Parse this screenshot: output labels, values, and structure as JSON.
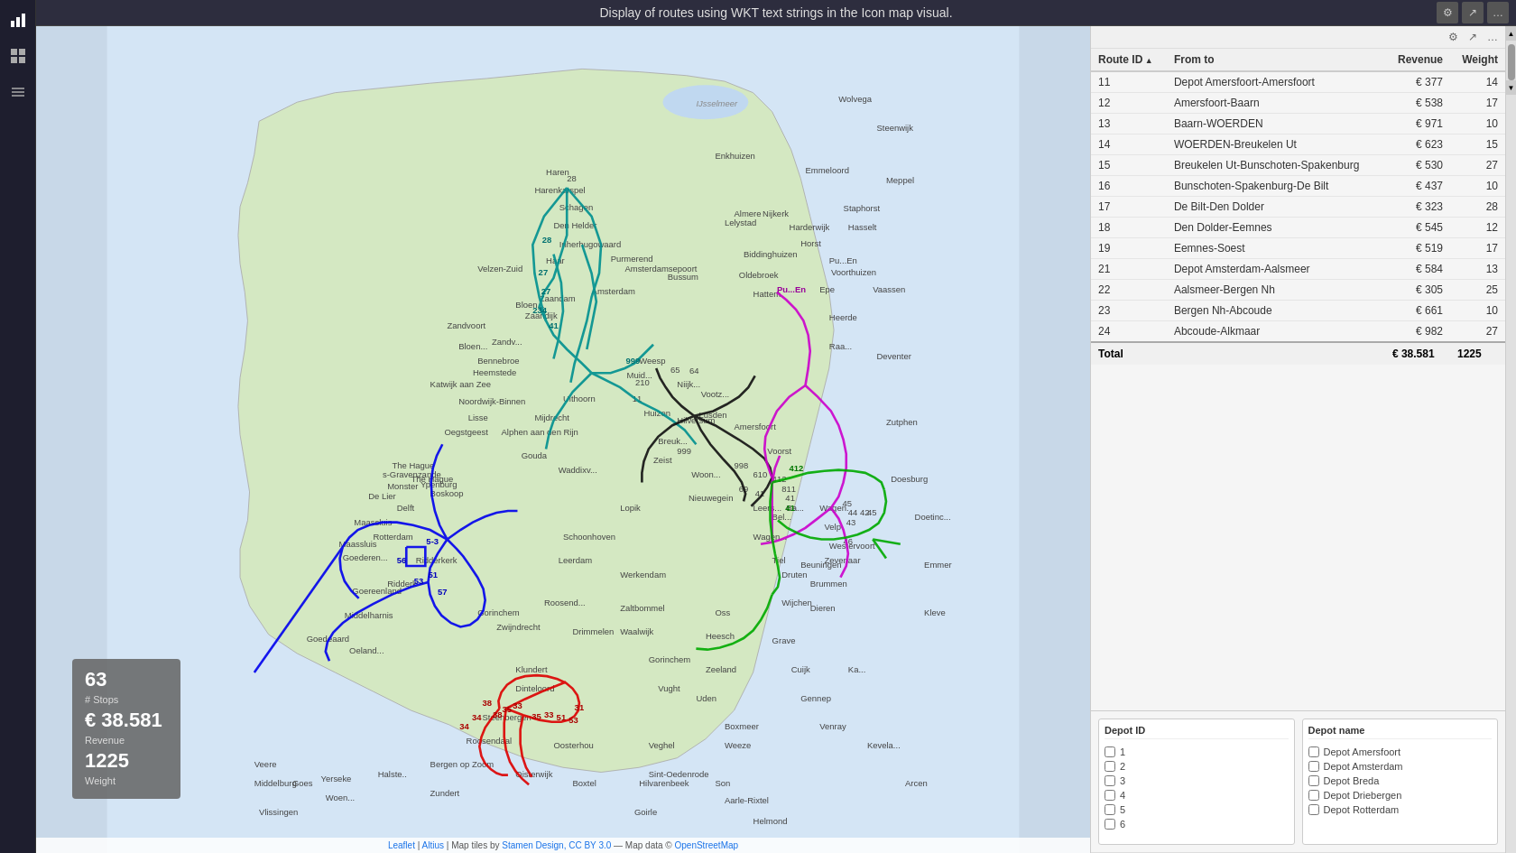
{
  "title": "Display of routes using WKT text strings in the Icon map visual.",
  "sidebar": {
    "icons": [
      {
        "name": "bar-chart-icon",
        "symbol": "📊"
      },
      {
        "name": "grid-icon",
        "symbol": "⊞"
      },
      {
        "name": "layers-icon",
        "symbol": "≡"
      }
    ]
  },
  "table": {
    "filter_icon_label": "⊞",
    "export_icon_label": "↗",
    "columns": [
      "Route ID",
      "From to",
      "Revenue",
      "Weight"
    ],
    "rows": [
      {
        "route_id": "11",
        "from_to": "Depot Amersfoort-Amersfoort",
        "revenue": "€ 377",
        "weight": "14"
      },
      {
        "route_id": "12",
        "from_to": "Amersfoort-Baarn",
        "revenue": "€ 538",
        "weight": "17"
      },
      {
        "route_id": "13",
        "from_to": "Baarn-WOERDEN",
        "revenue": "€ 971",
        "weight": "10"
      },
      {
        "route_id": "14",
        "from_to": "WOERDEN-Breukelen Ut",
        "revenue": "€ 623",
        "weight": "15"
      },
      {
        "route_id": "15",
        "from_to": "Breukelen Ut-Bunschoten-Spakenburg",
        "revenue": "€ 530",
        "weight": "27"
      },
      {
        "route_id": "16",
        "from_to": "Bunschoten-Spakenburg-De Bilt",
        "revenue": "€ 437",
        "weight": "10"
      },
      {
        "route_id": "17",
        "from_to": "De Bilt-Den Dolder",
        "revenue": "€ 323",
        "weight": "28"
      },
      {
        "route_id": "18",
        "from_to": "Den Dolder-Eemnes",
        "revenue": "€ 545",
        "weight": "12"
      },
      {
        "route_id": "19",
        "from_to": "Eemnes-Soest",
        "revenue": "€ 519",
        "weight": "17"
      },
      {
        "route_id": "21",
        "from_to": "Depot Amsterdam-Aalsmeer",
        "revenue": "€ 584",
        "weight": "13"
      },
      {
        "route_id": "22",
        "from_to": "Aalsmeer-Bergen Nh",
        "revenue": "€ 305",
        "weight": "25"
      },
      {
        "route_id": "23",
        "from_to": "Bergen Nh-Abcoude",
        "revenue": "€ 661",
        "weight": "10"
      },
      {
        "route_id": "24",
        "from_to": "Abcoude-Alkmaar",
        "revenue": "€ 982",
        "weight": "27"
      }
    ],
    "total_label": "Total",
    "total_revenue": "€ 38.581",
    "total_weight": "1225"
  },
  "filters": {
    "depot_id_title": "Depot ID",
    "depot_id_items": [
      "1",
      "2",
      "3",
      "4",
      "5",
      "6"
    ],
    "depot_name_title": "Depot name",
    "depot_name_items": [
      "Depot Amersfoort",
      "Depot Amsterdam",
      "Depot Breda",
      "Depot Driebergen",
      "Depot Rotterdam"
    ]
  },
  "tooltip": {
    "stops_value": "63",
    "stops_label": "# Stops",
    "revenue_value": "€ 38.581",
    "revenue_label": "Revenue",
    "weight_value": "1225",
    "weight_label": "Weight"
  },
  "attribution": {
    "leaflet": "Leaflet",
    "pipe1": " | ",
    "altius": "Altius",
    "pipe2": " | Map tiles by ",
    "stamen": "Stamen Design, CC BY 3.0",
    "pipe3": " — Map data © ",
    "osm": "OpenStreetMap"
  },
  "colors": {
    "teal_route": "#00a0a0",
    "blue_route": "#0000ff",
    "red_route": "#dd0000",
    "black_route": "#222222",
    "green_route": "#00cc00",
    "magenta_route": "#cc00cc",
    "accent": "#1a73e8"
  }
}
